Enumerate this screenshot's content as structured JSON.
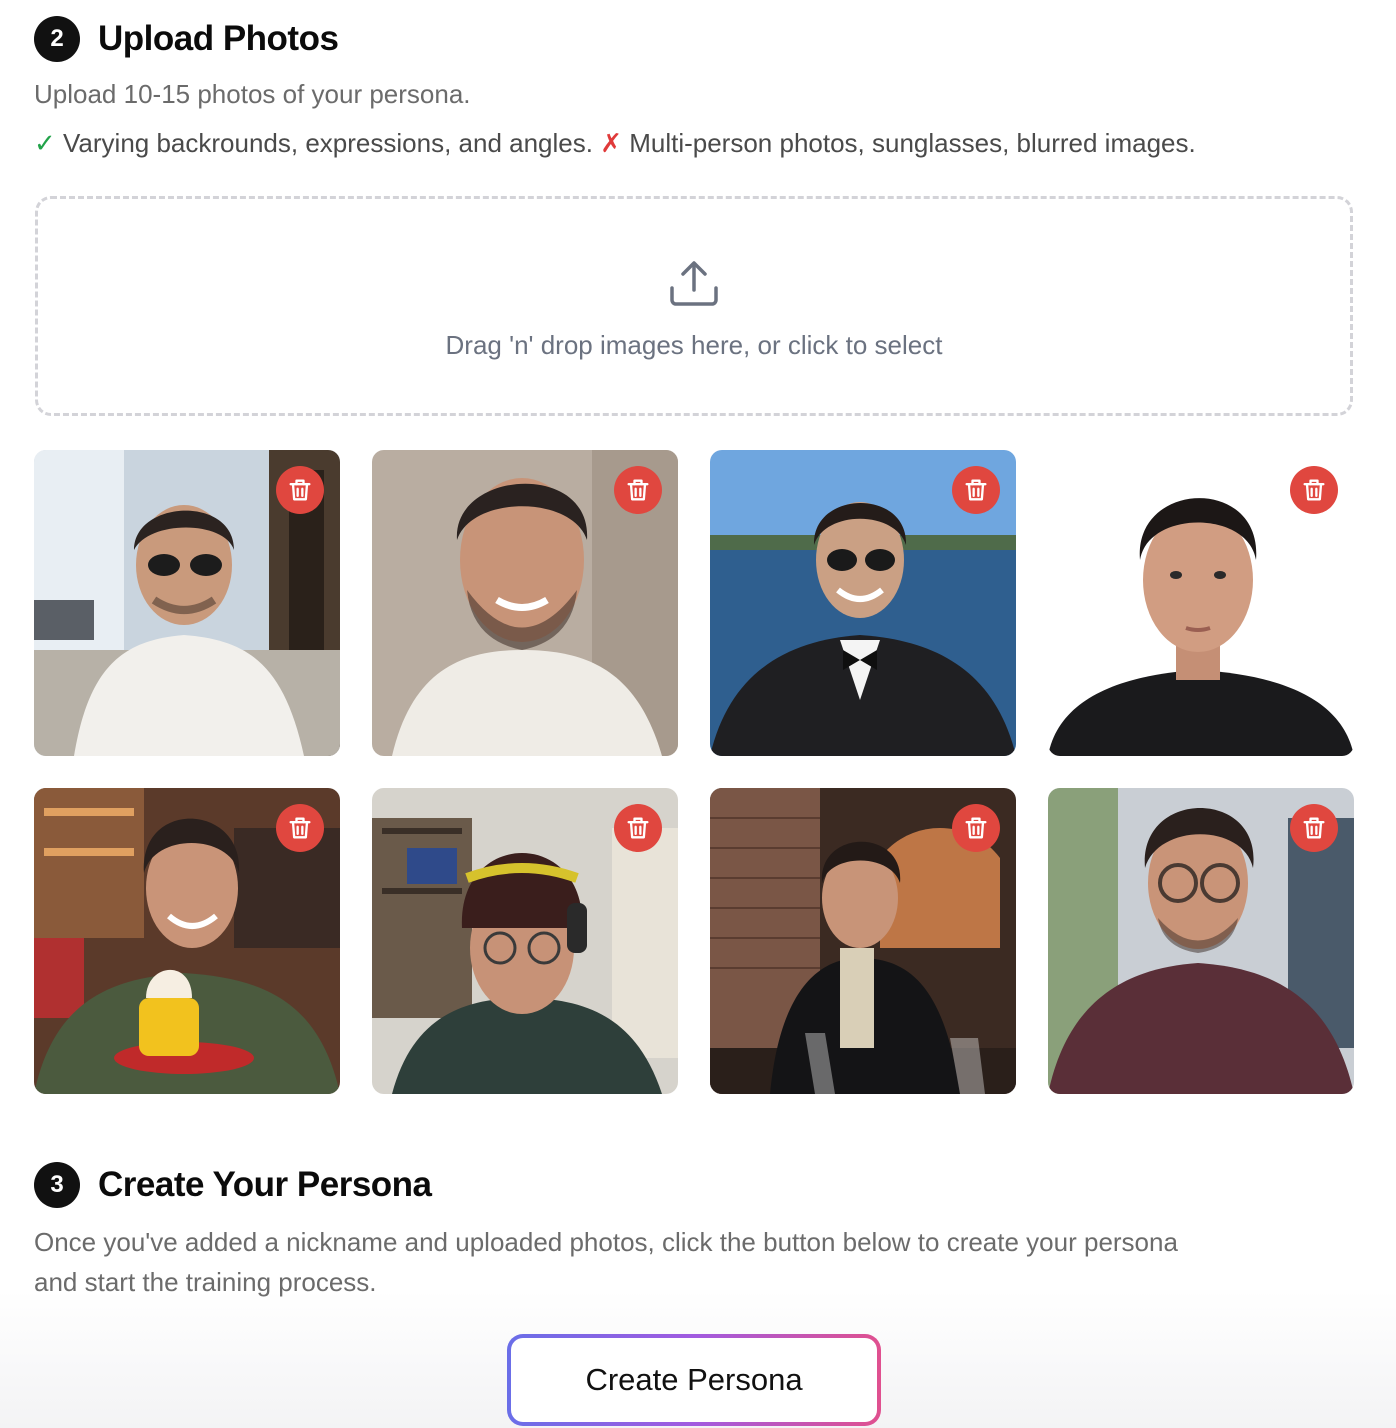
{
  "upload_section": {
    "step_number": "2",
    "title": "Upload Photos",
    "description": "Upload 10-15 photos of your persona.",
    "do_mark": "✓",
    "do_text": " Varying backrounds, expressions, and angles.",
    "dont_mark": " ✗",
    "dont_text": " Multi-person photos, sunglasses, blurred images.",
    "dropzone_text": "Drag 'n' drop images here, or click to select",
    "photos": [
      {
        "description": "street cafe selfie with sunglasses, white t-shirt"
      },
      {
        "description": "indoor close-up selfie, white t-shirt"
      },
      {
        "description": "selfie by the water in tuxedo with bow tie and sunglasses"
      },
      {
        "description": "portrait on white background, dark shirt"
      },
      {
        "description": "restaurant photo, green fleece, yellow cup with whipped cream"
      },
      {
        "description": "selfie with knit beanie and headphones, peace sign"
      },
      {
        "description": "bar photo with brick wall, wine glasses, peace sign"
      },
      {
        "description": "selfie with glasses, maroon hoodie, balcony"
      }
    ]
  },
  "create_section": {
    "step_number": "3",
    "title": "Create Your Persona",
    "description_line1": "Once you've added a nickname and uploaded photos, click the button below to create your persona",
    "description_line2": "and start the training process.",
    "button_label": "Create Persona"
  },
  "colors": {
    "accent_gradient_start": "#6a6ee8",
    "accent_gradient_end": "#e0508f",
    "delete_button": "#e0473f",
    "check_green": "#22a34a",
    "cross_red": "#e03a3a"
  }
}
